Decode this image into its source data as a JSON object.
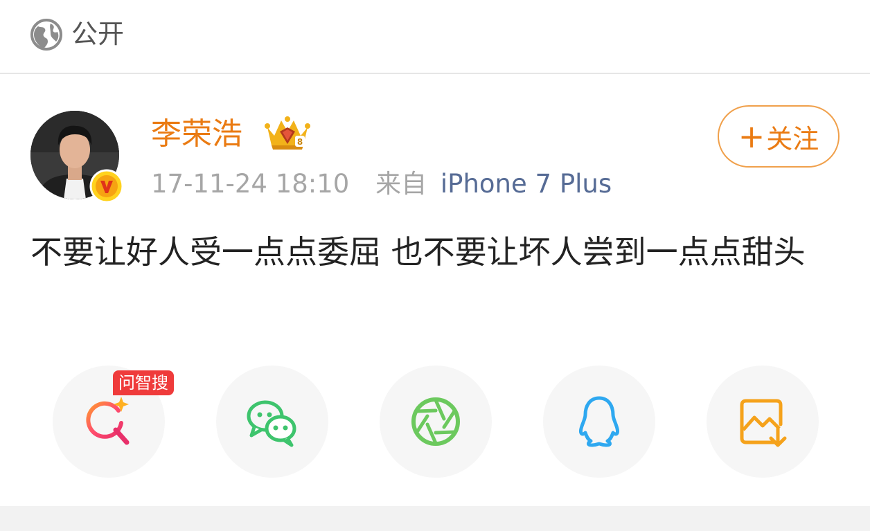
{
  "visibility": {
    "label": "公开",
    "icon": "globe-icon"
  },
  "post": {
    "author": "李荣浩",
    "time": "17-11-24 18:10",
    "from_label": "来自",
    "device": "iPhone 7 Plus",
    "follow_plus": "+",
    "follow_label": "关注",
    "content": "不要让好人受一点点委屈 也不要让坏人尝到一点点甜头",
    "verified_icon": "verified-v-badge-icon",
    "crown_icon": "crown-member-icon"
  },
  "share": {
    "badge": "问智搜",
    "buttons": [
      {
        "name": "ai-search-share",
        "icon": "ai-search-icon"
      },
      {
        "name": "wechat-share",
        "icon": "wechat-icon"
      },
      {
        "name": "moments-share",
        "icon": "moments-aperture-icon"
      },
      {
        "name": "qq-share",
        "icon": "qq-penguin-icon"
      },
      {
        "name": "save-image-share",
        "icon": "save-image-icon"
      }
    ]
  },
  "colors": {
    "accent": "#ea7b13",
    "device_link": "#566b95",
    "muted": "#a6a6a6",
    "badge_red": "#ef3b3b",
    "wechat_green": "#3ec46d",
    "moments_green": "#6cc95e",
    "qq_blue": "#2ea8f0",
    "save_orange": "#f5a21b"
  }
}
